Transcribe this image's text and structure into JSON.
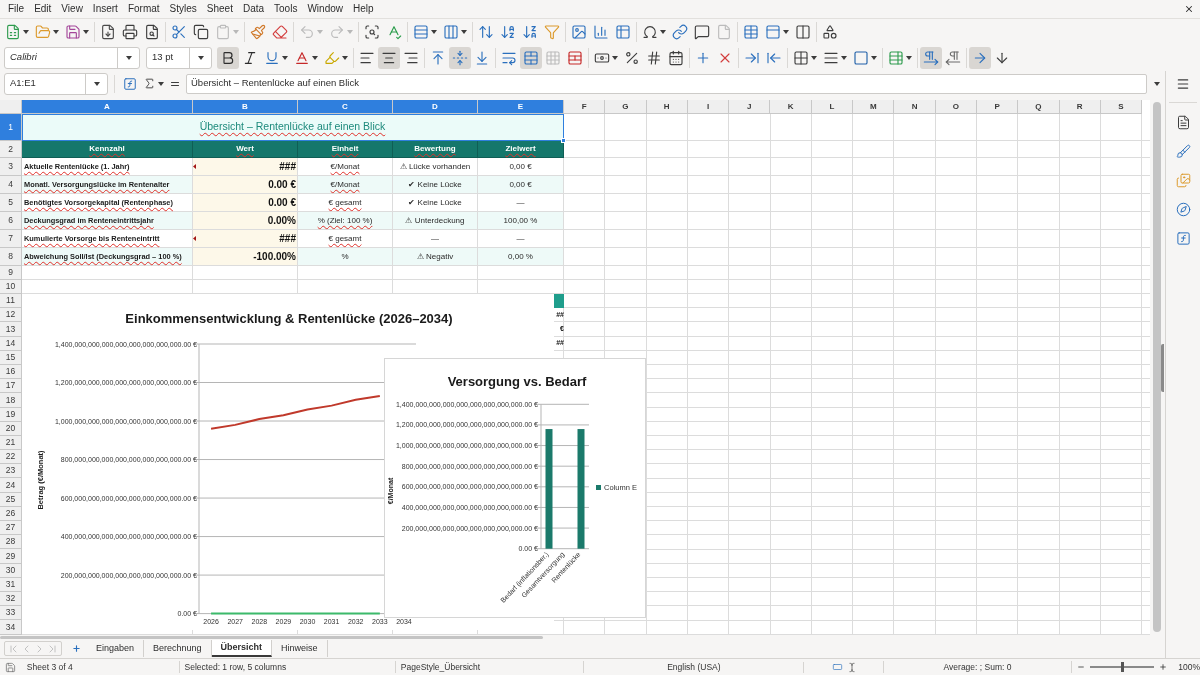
{
  "menu_bar": {
    "items": [
      "File",
      "Edit",
      "View",
      "Insert",
      "Format",
      "Styles",
      "Sheet",
      "Data",
      "Tools",
      "Window",
      "Help"
    ]
  },
  "standard_toolbar": {
    "groups": [
      [
        {
          "kind": "new",
          "dropdown": true,
          "disabled": false
        },
        {
          "kind": "open",
          "dropdown": true,
          "disabled": false
        },
        {
          "kind": "save",
          "dropdown": true,
          "disabled": false
        }
      ],
      [
        {
          "kind": "export_pdf",
          "dropdown": false,
          "disabled": false
        },
        {
          "kind": "print",
          "dropdown": false,
          "disabled": false
        },
        {
          "kind": "print_preview",
          "dropdown": false,
          "disabled": false
        }
      ],
      [
        {
          "kind": "cut",
          "dropdown": false,
          "disabled": false
        },
        {
          "kind": "copy",
          "dropdown": false,
          "disabled": false
        },
        {
          "kind": "paste",
          "dropdown": true,
          "disabled": true
        }
      ],
      [
        {
          "kind": "clone",
          "dropdown": false,
          "disabled": false
        },
        {
          "kind": "clear_format",
          "dropdown": false,
          "disabled": false
        }
      ],
      [
        {
          "kind": "undo",
          "dropdown": true,
          "disabled": true
        },
        {
          "kind": "redo",
          "dropdown": true,
          "disabled": true
        }
      ],
      [
        {
          "kind": "find_replace",
          "dropdown": false,
          "disabled": false
        },
        {
          "kind": "spelling",
          "dropdown": false,
          "disabled": false
        }
      ],
      [
        {
          "kind": "row",
          "dropdown": true,
          "disabled": false
        },
        {
          "kind": "column",
          "dropdown": true,
          "disabled": false
        }
      ],
      [
        {
          "kind": "sort",
          "dropdown": false,
          "disabled": false
        },
        {
          "kind": "sort_asc",
          "dropdown": false,
          "disabled": false
        },
        {
          "kind": "sort_desc",
          "dropdown": false,
          "disabled": false
        },
        {
          "kind": "autofilter",
          "dropdown": false,
          "disabled": false
        }
      ],
      [
        {
          "kind": "image",
          "dropdown": false,
          "disabled": false
        },
        {
          "kind": "chart",
          "dropdown": false,
          "disabled": false
        },
        {
          "kind": "pivot",
          "dropdown": false,
          "disabled": false
        }
      ],
      [
        {
          "kind": "special_char",
          "dropdown": true,
          "disabled": false
        },
        {
          "kind": "hyperlink",
          "dropdown": false,
          "disabled": false
        },
        {
          "kind": "comment",
          "dropdown": false,
          "disabled": false
        },
        {
          "kind": "header_footer",
          "dropdown": false,
          "disabled": true
        }
      ],
      [
        {
          "kind": "print_area",
          "dropdown": false,
          "disabled": false
        },
        {
          "kind": "freeze",
          "dropdown": true,
          "disabled": false
        },
        {
          "kind": "split",
          "dropdown": false,
          "disabled": false
        }
      ],
      [
        {
          "kind": "draw",
          "dropdown": false,
          "disabled": false
        }
      ]
    ]
  },
  "formatting_toolbar": {
    "font_name": "Calibri",
    "font_size": "13 pt",
    "groups": [
      [
        {
          "kind": "bold",
          "pressed": true,
          "dropdown": false,
          "disabled": false
        },
        {
          "kind": "italic",
          "pressed": false,
          "dropdown": false,
          "disabled": false
        },
        {
          "kind": "underline",
          "pressed": false,
          "dropdown": true,
          "disabled": false
        },
        {
          "kind": "font_color",
          "pressed": false,
          "dropdown": true,
          "disabled": false
        },
        {
          "kind": "highlight",
          "pressed": false,
          "dropdown": true,
          "disabled": false
        }
      ],
      [
        {
          "kind": "align_left",
          "pressed": false,
          "dropdown": false,
          "disabled": false
        },
        {
          "kind": "align_center",
          "pressed": true,
          "dropdown": false,
          "disabled": false
        },
        {
          "kind": "align_right",
          "pressed": false,
          "dropdown": false,
          "disabled": false
        }
      ],
      [
        {
          "kind": "align_top",
          "pressed": false,
          "dropdown": false,
          "disabled": false
        },
        {
          "kind": "align_middle",
          "pressed": true,
          "dropdown": false,
          "disabled": false
        },
        {
          "kind": "align_bottom",
          "pressed": false,
          "dropdown": false,
          "disabled": false
        }
      ],
      [
        {
          "kind": "wrap",
          "pressed": false,
          "dropdown": false,
          "disabled": false
        },
        {
          "kind": "merge_center",
          "pressed": true,
          "dropdown": false,
          "disabled": false
        },
        {
          "kind": "merge",
          "pressed": false,
          "dropdown": false,
          "disabled": true
        },
        {
          "kind": "unmerge",
          "pressed": false,
          "dropdown": false,
          "disabled": false
        }
      ],
      [
        {
          "kind": "currency",
          "pressed": false,
          "dropdown": true,
          "disabled": false
        },
        {
          "kind": "percent",
          "pressed": false,
          "dropdown": false,
          "disabled": false
        },
        {
          "kind": "number",
          "pressed": false,
          "dropdown": false,
          "disabled": false
        },
        {
          "kind": "date",
          "pressed": false,
          "dropdown": false,
          "disabled": false
        }
      ],
      [
        {
          "kind": "add_decimal",
          "pressed": false,
          "dropdown": false,
          "disabled": false
        },
        {
          "kind": "delete_decimal",
          "pressed": false,
          "dropdown": false,
          "disabled": false
        }
      ],
      [
        {
          "kind": "indent_more",
          "pressed": false,
          "dropdown": false,
          "disabled": false
        },
        {
          "kind": "indent_less",
          "pressed": false,
          "dropdown": false,
          "disabled": false
        }
      ],
      [
        {
          "kind": "borders",
          "pressed": false,
          "dropdown": true,
          "disabled": false
        },
        {
          "kind": "border_style",
          "pressed": false,
          "dropdown": true,
          "disabled": false
        },
        {
          "kind": "border_color",
          "pressed": false,
          "dropdown": true,
          "disabled": false
        }
      ],
      [
        {
          "kind": "conditional",
          "pressed": false,
          "dropdown": true,
          "disabled": false
        }
      ],
      [
        {
          "kind": "ltr",
          "pressed": true,
          "dropdown": false,
          "disabled": false
        },
        {
          "kind": "rtl",
          "pressed": false,
          "dropdown": false,
          "disabled": false
        }
      ],
      [
        {
          "kind": "text_ltr",
          "pressed": true,
          "dropdown": false,
          "disabled": false
        },
        {
          "kind": "vertical_text",
          "pressed": false,
          "dropdown": false,
          "disabled": false
        }
      ]
    ]
  },
  "formula_bar": {
    "name_box": "A1:E1",
    "content": "Übersicht – Rentenlücke auf einen Blick"
  },
  "column_headers": [
    {
      "label": "A",
      "selected": true
    },
    {
      "label": "B",
      "selected": true
    },
    {
      "label": "C",
      "selected": true
    },
    {
      "label": "D",
      "selected": true
    },
    {
      "label": "E",
      "selected": true
    },
    {
      "label": "F",
      "selected": false
    },
    {
      "label": "G",
      "selected": false
    },
    {
      "label": "H",
      "selected": false
    },
    {
      "label": "I",
      "selected": false
    },
    {
      "label": "J",
      "selected": false
    },
    {
      "label": "K",
      "selected": false
    },
    {
      "label": "L",
      "selected": false
    },
    {
      "label": "M",
      "selected": false
    },
    {
      "label": "N",
      "selected": false
    },
    {
      "label": "O",
      "selected": false
    },
    {
      "label": "P",
      "selected": false
    },
    {
      "label": "Q",
      "selected": false
    },
    {
      "label": "R",
      "selected": false
    },
    {
      "label": "S",
      "selected": false
    }
  ],
  "row_headers": [
    {
      "label": "1",
      "selected": true
    },
    {
      "label": "2",
      "selected": false
    },
    {
      "label": "3",
      "selected": false
    },
    {
      "label": "4",
      "selected": false
    },
    {
      "label": "5",
      "selected": false
    },
    {
      "label": "6",
      "selected": false
    },
    {
      "label": "7",
      "selected": false
    },
    {
      "label": "8",
      "selected": false
    },
    {
      "label": "9",
      "selected": false
    },
    {
      "label": "10",
      "selected": false
    },
    {
      "label": "11",
      "selected": false
    },
    {
      "label": "12",
      "selected": false
    },
    {
      "label": "13",
      "selected": false
    },
    {
      "label": "14",
      "selected": false
    },
    {
      "label": "15",
      "selected": false
    },
    {
      "label": "16",
      "selected": false
    },
    {
      "label": "17",
      "selected": false
    },
    {
      "label": "18",
      "selected": false
    },
    {
      "label": "19",
      "selected": false
    },
    {
      "label": "20",
      "selected": false
    },
    {
      "label": "21",
      "selected": false
    },
    {
      "label": "22",
      "selected": false
    },
    {
      "label": "23",
      "selected": false
    },
    {
      "label": "24",
      "selected": false
    },
    {
      "label": "25",
      "selected": false
    },
    {
      "label": "26",
      "selected": false
    },
    {
      "label": "27",
      "selected": false
    },
    {
      "label": "28",
      "selected": false
    },
    {
      "label": "29",
      "selected": false
    },
    {
      "label": "30",
      "selected": false
    },
    {
      "label": "31",
      "selected": false
    },
    {
      "label": "32",
      "selected": false
    },
    {
      "label": "33",
      "selected": false
    },
    {
      "label": "34",
      "selected": false
    }
  ],
  "table": {
    "title": {
      "text": "Übersicht – Rentenlücke auf einen Blick",
      "spell_error": true,
      "selected": true
    },
    "columns": [
      {
        "text": "Kennzahl",
        "spell_error": true
      },
      {
        "text": "Wert",
        "spell_error": true
      },
      {
        "text": "Einheit",
        "spell_error": true
      },
      {
        "text": "Bewertung",
        "spell_error": true
      },
      {
        "text": "Zielwert",
        "spell_error": true
      }
    ],
    "rows": [
      {
        "shaded": false,
        "overflow": true,
        "cells": [
          {
            "text": "Aktuelle Rentenlücke (1. Jahr)",
            "spell_error": true
          },
          {
            "text": "###",
            "spell_error": false
          },
          {
            "text": "€/Monat",
            "spell_error": true
          },
          {
            "text": "⚠ Lücke vorhanden",
            "spell_error": false
          },
          {
            "text": "0,00 €",
            "spell_error": false
          }
        ]
      },
      {
        "shaded": true,
        "overflow": false,
        "cells": [
          {
            "text": "Monatl. Versorgungslücke im Rentenalter",
            "spell_error": true
          },
          {
            "text": "0.00 €",
            "spell_error": false
          },
          {
            "text": "€/Monat",
            "spell_error": true
          },
          {
            "text": "✔ Keine Lücke",
            "spell_error": false
          },
          {
            "text": "0,00 €",
            "spell_error": false
          }
        ]
      },
      {
        "shaded": false,
        "overflow": false,
        "cells": [
          {
            "text": "Benötigtes Vorsorgekapital (Rentenphase)",
            "spell_error": true
          },
          {
            "text": "0.00 €",
            "spell_error": false
          },
          {
            "text": "€ gesamt",
            "spell_error": true
          },
          {
            "text": "✔ Keine Lücke",
            "spell_error": false
          },
          {
            "text": "—",
            "spell_error": false
          }
        ]
      },
      {
        "shaded": true,
        "overflow": false,
        "cells": [
          {
            "text": "Deckungsgrad im Renteneintrittsjahr",
            "spell_error": true
          },
          {
            "text": "0.00%",
            "spell_error": false
          },
          {
            "text": "% (Ziel: 100 %)",
            "spell_error": true
          },
          {
            "text": "⚠ Unterdeckung",
            "spell_error": false
          },
          {
            "text": "100,00 %",
            "spell_error": false
          }
        ]
      },
      {
        "shaded": false,
        "overflow": true,
        "cells": [
          {
            "text": "Kumulierte Vorsorge bis Renteneintritt",
            "spell_error": true
          },
          {
            "text": "###",
            "spell_error": false
          },
          {
            "text": "€ gesamt",
            "spell_error": true
          },
          {
            "text": "—",
            "spell_error": false
          },
          {
            "text": "—",
            "spell_error": false
          }
        ]
      },
      {
        "shaded": true,
        "overflow": false,
        "cells": [
          {
            "text": "Abweichung Soll/Ist (Deckungsgrad – 100 %)",
            "spell_error": true
          },
          {
            "text": "-100.00%",
            "spell_error": false
          },
          {
            "text": "%",
            "spell_error": false
          },
          {
            "text": "⚠ Negativ",
            "spell_error": false
          },
          {
            "text": "0,00 %",
            "spell_error": false
          }
        ]
      }
    ]
  },
  "column_e_peek": [
    {
      "kind": "header"
    },
    {
      "kind": "value",
      "text": "##"
    },
    {
      "kind": "value",
      "text": "€"
    },
    {
      "kind": "value",
      "text": "##"
    }
  ],
  "income_chart": {
    "chart_data": {
      "type": "line",
      "title": "Einkommensentwicklung & Rentenlücke (2026–2034)",
      "ylabel": "Betrag (€/Monat)",
      "categories": [
        "2026",
        "2027",
        "2028",
        "2029",
        "2030",
        "2031",
        "2032",
        "2033",
        "2034"
      ],
      "series": [
        {
          "color": "#c0392b",
          "values": [
            9.6e+26,
            9.8e+26,
            1.01e+27,
            1.03e+27,
            1.06e+27,
            1.08e+27,
            1.11e+27,
            1.13e+27,
            null
          ]
        },
        {
          "color": "#3cba6b",
          "values": [
            0,
            0,
            0,
            0,
            0,
            0,
            0,
            0,
            null
          ]
        }
      ],
      "ylim": [
        0,
        1.4e+27
      ],
      "grid": true,
      "yticks": [
        {
          "value": 0,
          "label": "0.00 €"
        },
        {
          "value": 2e+26,
          "label": "200,000,000,000,000,000,000,000,000.00 €"
        },
        {
          "value": 4e+26,
          "label": "400,000,000,000,000,000,000,000,000.00 €"
        },
        {
          "value": 6e+26,
          "label": "600,000,000,000,000,000,000,000,000.00 €"
        },
        {
          "value": 8e+26,
          "label": "800,000,000,000,000,000,000,000,000.00 €"
        },
        {
          "value": 1e+27,
          "label": "1,000,000,000,000,000,000,000,000,000.00 €"
        },
        {
          "value": 1.2e+27,
          "label": "1,200,000,000,000,000,000,000,000,000.00 €"
        },
        {
          "value": 1.4e+27,
          "label": "1,400,000,000,000,000,000,000,000,000.00 €"
        }
      ]
    }
  },
  "coverage_chart": {
    "chart_data": {
      "type": "bar",
      "title": "Versorgung vs. Bedarf",
      "ylabel": "€/Monat",
      "categories": [
        "Bedarf (inflationsber.)",
        "Gesamtversorgung",
        "Rentenlücke"
      ],
      "series": [
        {
          "name": "Column E",
          "color": "#1b7a6b",
          "values": [
            1.16e+27,
            0,
            1.16e+27
          ]
        }
      ],
      "ylim": [
        0,
        1.4e+27
      ],
      "grid": true,
      "yticks": [
        {
          "value": 0,
          "label": "0.00 €"
        },
        {
          "value": 2e+26,
          "label": "200,000,000,000,000,000,000,000,000.00 €"
        },
        {
          "value": 4e+26,
          "label": "400,000,000,000,000,000,000,000,000.00 €"
        },
        {
          "value": 6e+26,
          "label": "600,000,000,000,000,000,000,000,000.00 €"
        },
        {
          "value": 8e+26,
          "label": "800,000,000,000,000,000,000,000,000.00 €"
        },
        {
          "value": 1e+27,
          "label": "1,000,000,000,000,000,000,000,000,000.00 €"
        },
        {
          "value": 1.2e+27,
          "label": "1,200,000,000,000,000,000,000,000,000.00 €"
        },
        {
          "value": 1.4e+27,
          "label": "1,400,000,000,000,000,000,000,000,000.00 €"
        }
      ]
    }
  },
  "sheet_tabs": [
    {
      "label": "Eingaben",
      "selected": false
    },
    {
      "label": "Berechnung",
      "selected": false
    },
    {
      "label": "Übersicht",
      "selected": true
    },
    {
      "label": "Hinweise",
      "selected": false
    }
  ],
  "status_bar": {
    "sheet": "Sheet 3 of 4",
    "selection": "Selected: 1 row, 5 columns",
    "page_style": "PageStyle_Übersicht",
    "language": "English (USA)",
    "summary": "Average: ; Sum: 0",
    "zoom": "100%"
  },
  "zoom_slider": {
    "level": 0.5
  }
}
